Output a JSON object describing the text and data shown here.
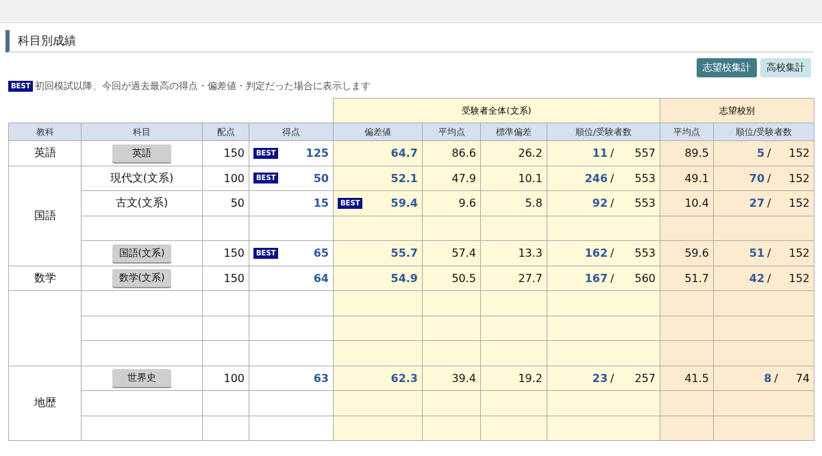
{
  "section_title": "科目別成績",
  "aggregate_buttons": [
    {
      "label": "志望校集計",
      "selected": true
    },
    {
      "label": "高校集計",
      "selected": false
    }
  ],
  "legend": {
    "badge": "BEST",
    "text": "初回模試以降、今回が過去最高の得点・偏差値・判定だった場合に表示します"
  },
  "table": {
    "group_headers": [
      {
        "label": "受験者全体(文系)",
        "kind": "all"
      },
      {
        "label": "志望校別",
        "kind": "school"
      }
    ],
    "columns": [
      "教科",
      "科目",
      "配点",
      "得点",
      "偏差値",
      "平均点",
      "標準偏差",
      "順位/受験者数",
      "平均点",
      "順位/受験者数"
    ],
    "groups": [
      {
        "name": "英語",
        "rows": [
          {
            "kind": "button",
            "subject": "英語",
            "full_marks": "150",
            "score_badge": "BEST",
            "score": "125",
            "deviation": "64.7",
            "average": "86.6",
            "std_dev": "26.2",
            "rank": "11",
            "rank_separator": "/",
            "examinees": "557",
            "school_average": "89.5",
            "school_rank": "5",
            "school_rank_separator": "/",
            "school_examinees": "152"
          }
        ]
      },
      {
        "name": "国語",
        "rows": [
          {
            "kind": "text",
            "subject": "現代文(文系)",
            "full_marks": "100",
            "score_badge": "BEST",
            "score": "50",
            "deviation": "52.1",
            "average": "47.9",
            "std_dev": "10.1",
            "rank": "246",
            "rank_separator": "/",
            "examinees": "553",
            "school_average": "49.1",
            "school_rank": "70",
            "school_rank_separator": "/",
            "school_examinees": "152"
          },
          {
            "kind": "text",
            "subject": "古文(文系)",
            "full_marks": "50",
            "score": "15",
            "deviation_badge": "BEST",
            "deviation": "59.4",
            "average": "9.6",
            "std_dev": "5.8",
            "rank": "92",
            "rank_separator": "/",
            "examinees": "553",
            "school_average": "10.4",
            "school_rank": "27",
            "school_rank_separator": "/",
            "school_examinees": "152"
          },
          {
            "kind": "empty"
          },
          {
            "kind": "button",
            "subject": "国語(文系)",
            "full_marks": "150",
            "score_badge": "BEST",
            "score": "65",
            "deviation": "55.7",
            "average": "57.4",
            "std_dev": "13.3",
            "rank": "162",
            "rank_separator": "/",
            "examinees": "553",
            "school_average": "59.6",
            "school_rank": "51",
            "school_rank_separator": "/",
            "school_examinees": "152"
          }
        ]
      },
      {
        "name": "数学",
        "rows": [
          {
            "kind": "button",
            "subject": "数学(文系)",
            "full_marks": "150",
            "score": "64",
            "deviation": "54.9",
            "average": "50.5",
            "std_dev": "27.7",
            "rank": "167",
            "rank_separator": "/",
            "examinees": "560",
            "school_average": "51.7",
            "school_rank": "42",
            "school_rank_separator": "/",
            "school_examinees": "152"
          }
        ]
      },
      {
        "rows": [
          {
            "kind": "empty"
          },
          {
            "kind": "empty"
          },
          {
            "kind": "empty"
          }
        ]
      },
      {
        "name": "地歴",
        "rows": [
          {
            "kind": "button",
            "subject": "世界史",
            "full_marks": "100",
            "score": "63",
            "deviation": "62.3",
            "average": "39.4",
            "std_dev": "19.2",
            "rank": "23",
            "rank_separator": "/",
            "examinees": "257",
            "school_average": "41.5",
            "school_rank": "8",
            "school_rank_separator": "/",
            "school_examinees": "74"
          },
          {
            "kind": "empty"
          },
          {
            "kind": "empty"
          }
        ]
      }
    ]
  }
}
